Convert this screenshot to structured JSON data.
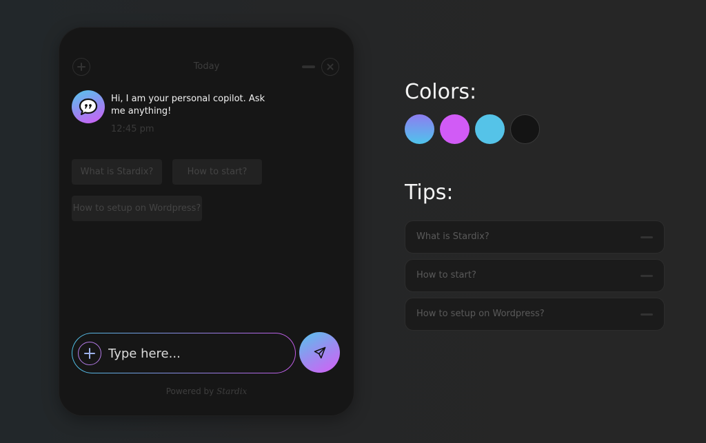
{
  "widget": {
    "header": {
      "title": "Today"
    },
    "message": {
      "text": "Hi, I am your personal copilot. Ask me anything!",
      "time": "12:45 pm",
      "avatar_icon": "chat-bubble-quote-icon"
    },
    "suggestions": [
      {
        "label": "What is Stardix?"
      },
      {
        "label": "How to start?"
      },
      {
        "label": "How to setup on Wordpress?"
      }
    ],
    "composer": {
      "placeholder": "Type here..."
    },
    "footer": {
      "prefix": "Powered by",
      "brand": "Stardix"
    }
  },
  "panel": {
    "colors_title": "Colors:",
    "colors": [
      {
        "name": "gradient",
        "from": "#8d7df0",
        "to": "#4fc4ec"
      },
      {
        "name": "purple",
        "value": "#d15bf6"
      },
      {
        "name": "cyan",
        "value": "#55c3e8"
      },
      {
        "name": "black",
        "value": "#141414"
      }
    ],
    "tips_title": "Tips:",
    "tips": [
      {
        "label": "What is Stardix?"
      },
      {
        "label": "How to start?"
      },
      {
        "label": "How to setup on Wordpress?"
      }
    ]
  }
}
